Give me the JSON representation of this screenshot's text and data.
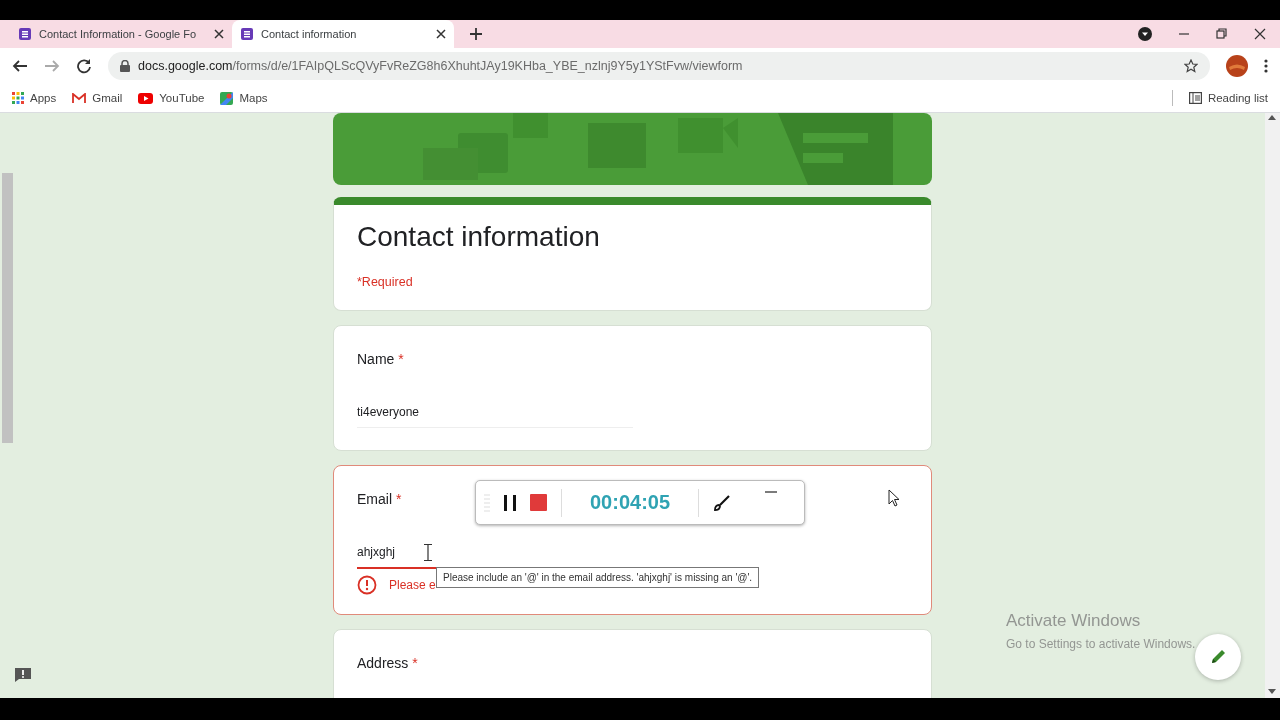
{
  "tabs": [
    {
      "title": "Contact Information - Google Fo",
      "selected": false
    },
    {
      "title": "Contact information",
      "selected": true
    }
  ],
  "address_bar": {
    "host": "docs.google.com",
    "path": "/forms/d/e/1FAIpQLScQVyFvReZG8h6XhuhtJAy19KHba_YBE_nzlnj9Y5y1YStFvw/viewform"
  },
  "bookmarks": [
    {
      "label": "Apps",
      "kind": "apps"
    },
    {
      "label": "Gmail",
      "kind": "gmail"
    },
    {
      "label": "YouTube",
      "kind": "youtube"
    },
    {
      "label": "Maps",
      "kind": "maps"
    }
  ],
  "reading_list": "Reading list",
  "form": {
    "title": "Contact information",
    "required_note": "*Required",
    "questions": [
      {
        "label": "Name",
        "required_mark": "*",
        "value": "ti4everyone",
        "invalid": false
      },
      {
        "label": "Email",
        "required_mark": "*",
        "value": "ahjxghj",
        "invalid": true,
        "error": "Please e"
      },
      {
        "label": "Address",
        "required_mark": "*",
        "invalid": false
      }
    ]
  },
  "tooltip": "Please include an '@' in the email address. 'ahjxghj' is missing an '@'.",
  "recorder": {
    "timer": "00:04:05"
  },
  "windows_notice": {
    "title": "Activate Windows",
    "message": "Go to Settings to activate Windows."
  }
}
